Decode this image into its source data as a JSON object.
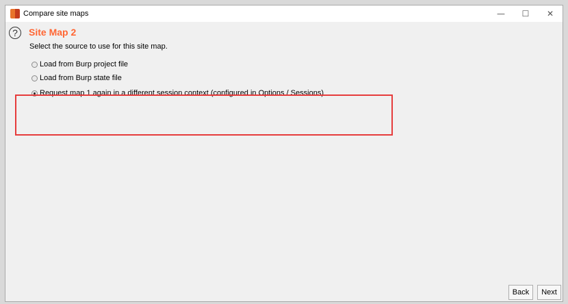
{
  "window": {
    "title": "Compare site maps"
  },
  "controls": {
    "minimize": "—",
    "maximize": "☐",
    "close": "✕"
  },
  "page": {
    "help_glyph": "?",
    "title": "Site Map 2",
    "instruction": "Select the source to use for this site map."
  },
  "options": [
    {
      "label": "Load from Burp project file",
      "selected": false
    },
    {
      "label": "Load from Burp state file",
      "selected": false
    },
    {
      "label": "Request map 1 again in a different session context (configured in Options / Sessions)",
      "selected": true
    }
  ],
  "buttons": {
    "back": "Back",
    "next": "Next"
  },
  "colors": {
    "title_accent": "#ff6633",
    "highlight_border": "#e63b3b"
  }
}
